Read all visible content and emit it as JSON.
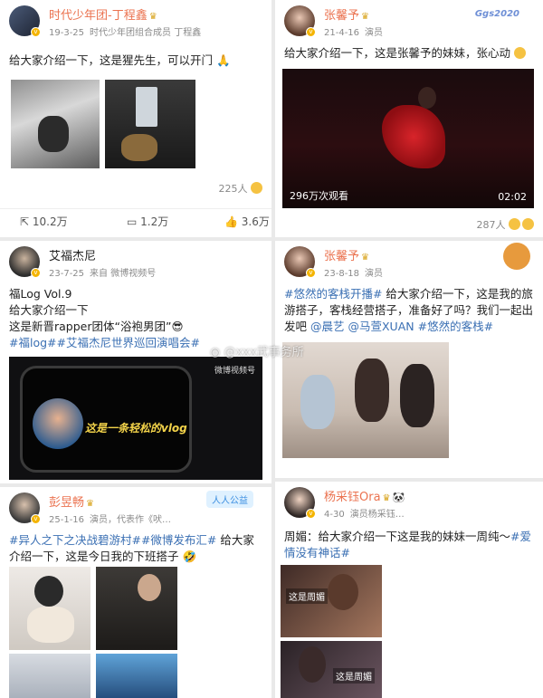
{
  "posts": [
    {
      "user": "时代少年团-丁程鑫",
      "date": "19-3-25",
      "source": "时代少年团组合成员 丁程鑫",
      "text": "给大家介绍一下，这是猩先生，可以开门",
      "likes": "225人",
      "actions": {
        "repost": "10.2万",
        "comment": "1.2万",
        "like": "3.6万"
      }
    },
    {
      "user": "张馨予",
      "date": "21-4-16",
      "source": "演员",
      "text": "给大家介绍一下，这是张馨予的妹妹，张心动",
      "video_views": "296万次观看",
      "video_duration": "02:02",
      "likes": "287人",
      "badge": "Ggs2020"
    },
    {
      "user": "艾福杰尼",
      "date": "23-7-25",
      "source": "来自 微博视频号",
      "line1": "福Log Vol.9",
      "line2": "给大家介绍一下",
      "line3": "这是新晋rapper团体“浴袍男团”",
      "tags": "#福log##艾福杰尼世界巡回演唱会#",
      "video_logo": "微博视频号",
      "video_caption": "这是一条轻松的vlog"
    },
    {
      "user": "张馨予",
      "date": "23-8-18",
      "source": "演员",
      "tag1": "#悠然的客栈开播#",
      "text1": " 给大家介绍一下，这是我的旅游搭子，客栈经营搭子，准备好了吗？我们一起出发吧 ",
      "mention1": "@晨艺",
      "mention2": "@马萱XUAN",
      "tag2": "#悠然的客栈#"
    },
    {
      "user": "彭昱畅",
      "date": "25-1-16",
      "source": "演员，代表作《吠…",
      "tags": "#异人之下之决战碧游村##微博发布汇#",
      "text": " 给大家介绍一下，这是今日我的下班搭子",
      "badge": "人人公益"
    },
    {
      "user": "杨采钰Ora",
      "date": "4-30",
      "source": "演员杨采钰…",
      "text_prefix": "周媚：给大家介绍一下这是我的妹妹一周纯～",
      "tag": "#爱情没有神话#",
      "img_label1": "这是周媚",
      "img_label2": "这是周媚"
    }
  ],
  "watermark": "@xxx武事务所",
  "colors": {
    "username": "#eb7350",
    "tag": "#3a6fb3",
    "background": "#e9e9e9"
  }
}
